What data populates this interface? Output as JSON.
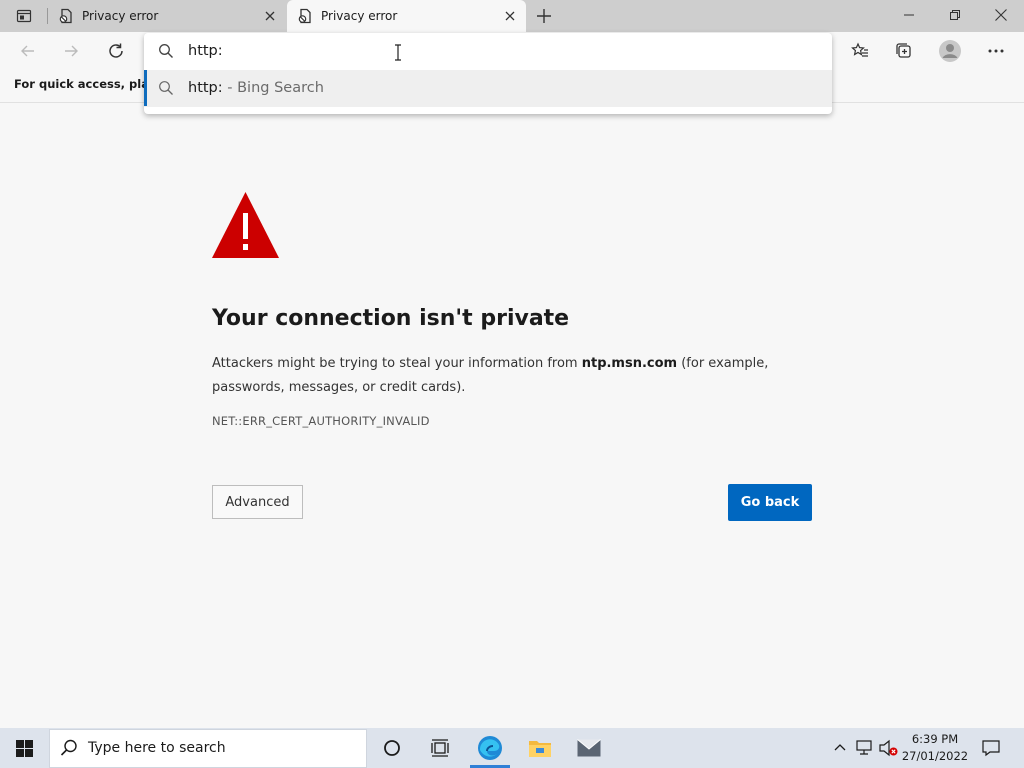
{
  "tabs": [
    {
      "title": "Privacy error"
    },
    {
      "title": "Privacy error"
    }
  ],
  "favorites_bar": {
    "text": "For quick access, place y"
  },
  "address_bar": {
    "input_value": "http:",
    "suggestion": {
      "query": "http:",
      "suffix": "- Bing Search"
    }
  },
  "error_page": {
    "title": "Your connection isn't private",
    "desc_before": "Attackers might be trying to steal your information from ",
    "host": "ntp.msn.com",
    "desc_after": " (for example, passwords, messages, or credit cards).",
    "code": "NET::ERR_CERT_AUTHORITY_INVALID",
    "advanced_label": "Advanced",
    "goback_label": "Go back"
  },
  "taskbar": {
    "search_placeholder": "Type here to search",
    "time": "6:39 PM",
    "date": "27/01/2022"
  },
  "colors": {
    "accent": "#0067c0",
    "warning_red": "#cc0000",
    "page_bg": "#f7f7f7",
    "tabstrip_bg": "#cecece",
    "taskbar_bg": "#dde3ec"
  }
}
